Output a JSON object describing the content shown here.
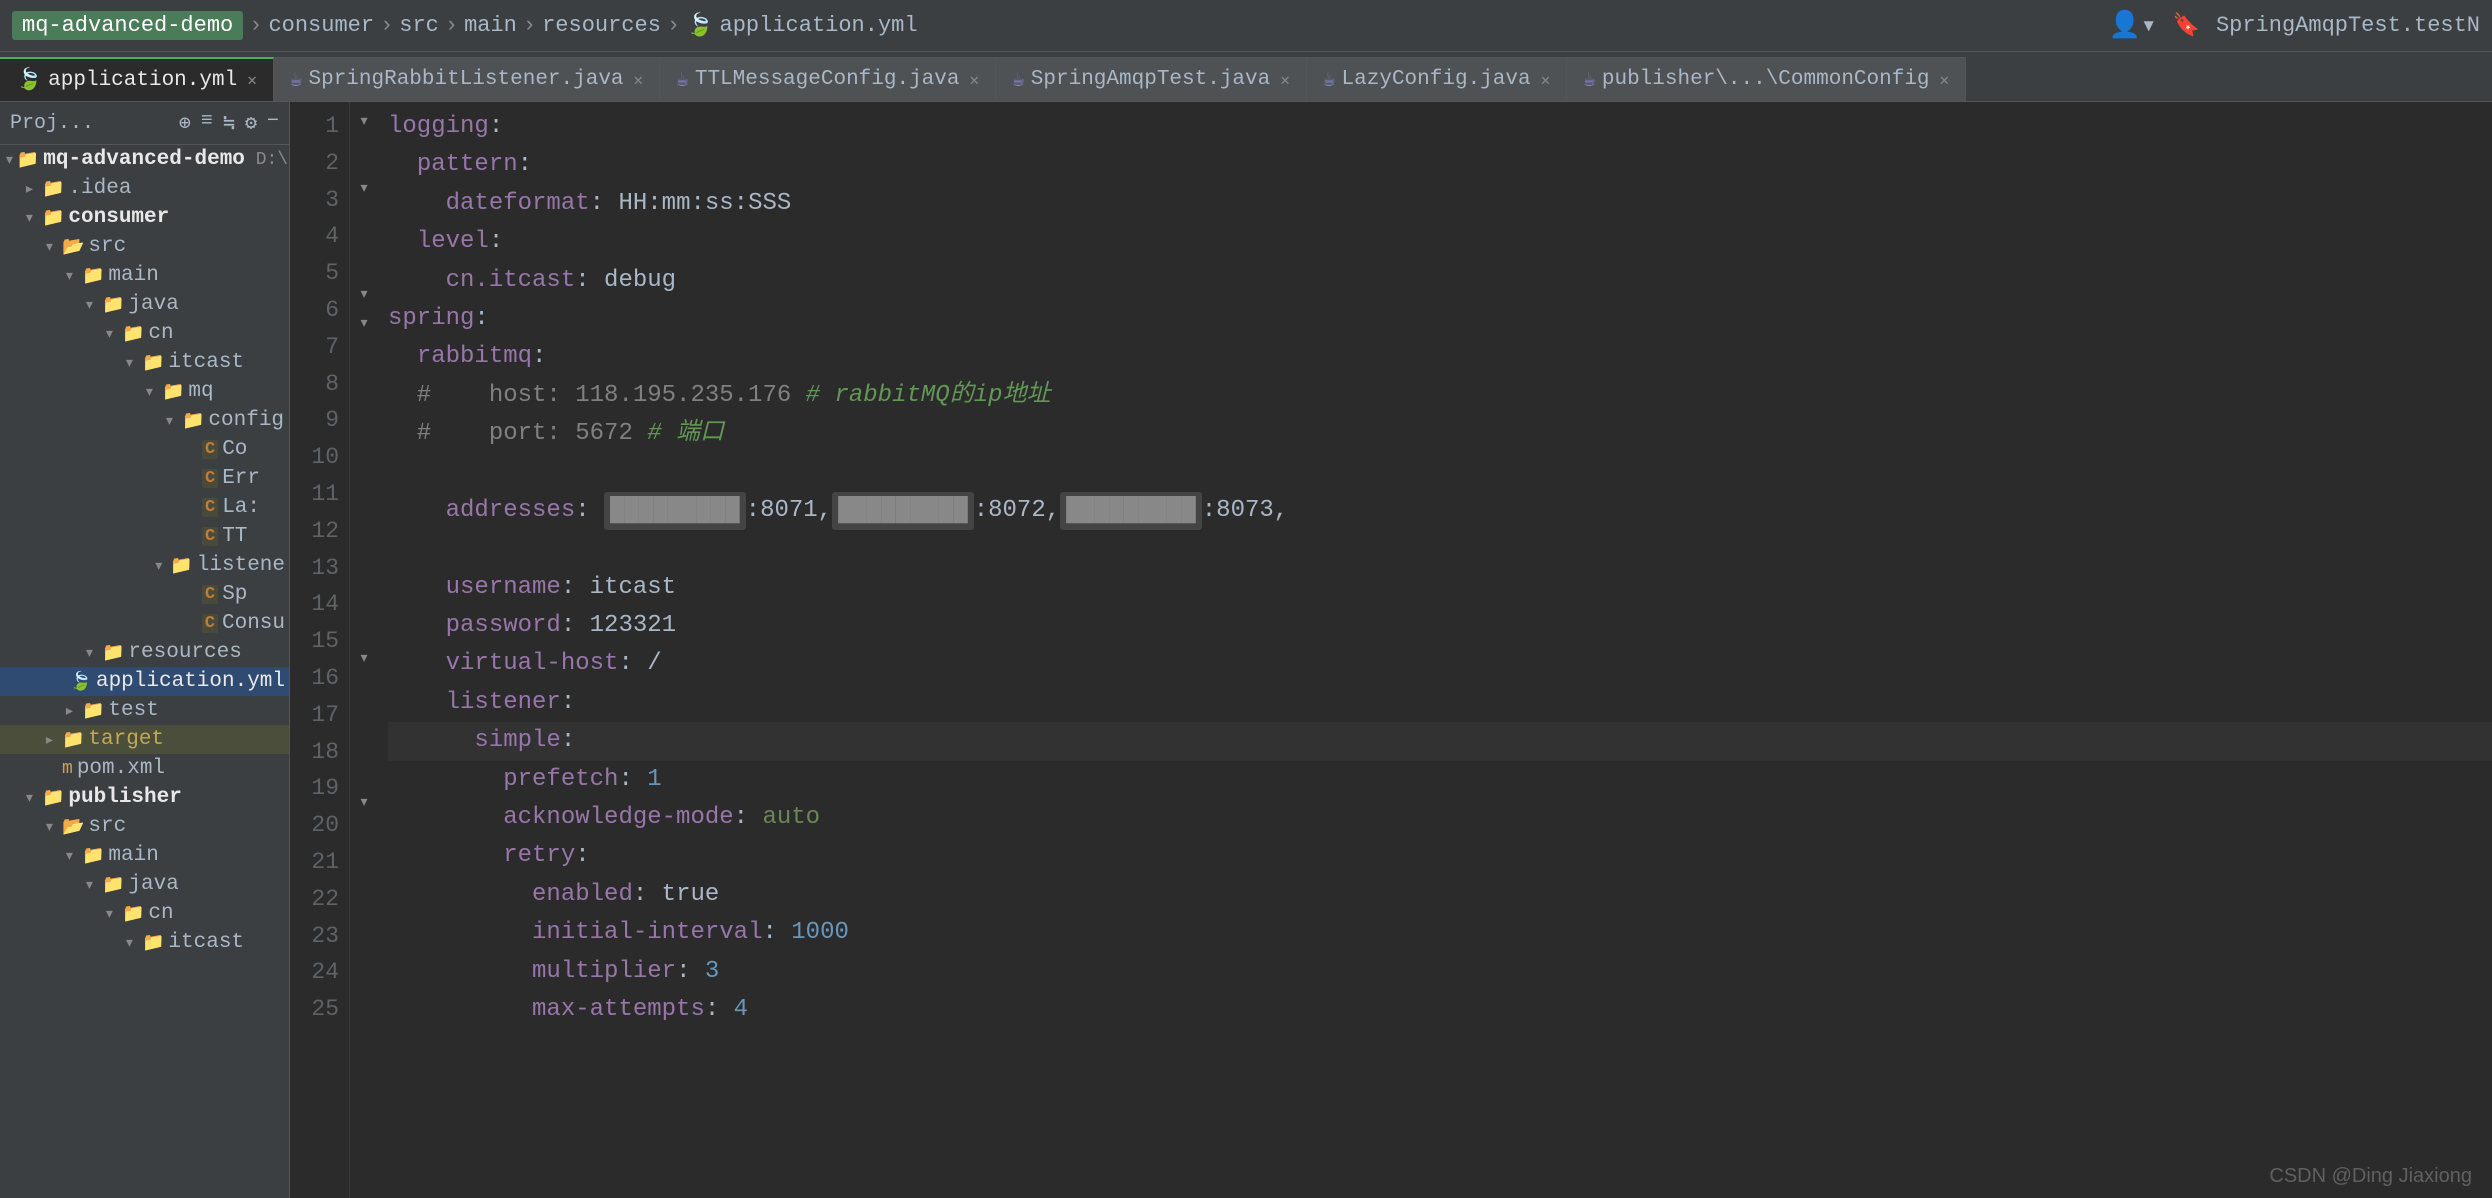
{
  "topbar": {
    "project_name": "mq-advanced-demo",
    "breadcrumb": [
      "consumer",
      "src",
      "main",
      "resources",
      "application.yml"
    ],
    "right_test": "SpringAmqpTest.testN"
  },
  "tabs": [
    {
      "id": "application-yml",
      "label": "application.yml",
      "type": "yaml",
      "active": true
    },
    {
      "id": "spring-rabbit-listener",
      "label": "SpringRabbitListener.java",
      "type": "java",
      "active": false
    },
    {
      "id": "ttl-message-config",
      "label": "TTLMessageConfig.java",
      "type": "java",
      "active": false
    },
    {
      "id": "spring-amqp-test",
      "label": "SpringAmqpTest.java",
      "type": "java",
      "active": false
    },
    {
      "id": "lazy-config",
      "label": "LazyConfig.java",
      "type": "java",
      "active": false
    },
    {
      "id": "publisher-common-config",
      "label": "publisher\\...\\CommonConfig",
      "type": "java",
      "active": false
    }
  ],
  "sidebar": {
    "header": "Proj...",
    "tree": [
      {
        "id": "root",
        "label": "mq-advanced-demo",
        "path": "D:\\Ding..",
        "level": 0,
        "type": "root",
        "expanded": true
      },
      {
        "id": "idea",
        "label": ".idea",
        "level": 1,
        "type": "folder",
        "expanded": false
      },
      {
        "id": "consumer",
        "label": "consumer",
        "level": 1,
        "type": "folder-bold",
        "expanded": true
      },
      {
        "id": "src",
        "label": "src",
        "level": 2,
        "type": "folder",
        "expanded": true
      },
      {
        "id": "main",
        "label": "main",
        "level": 3,
        "type": "folder",
        "expanded": true
      },
      {
        "id": "java",
        "label": "java",
        "level": 4,
        "type": "folder",
        "expanded": true
      },
      {
        "id": "cn",
        "label": "cn",
        "level": 5,
        "type": "folder",
        "expanded": true
      },
      {
        "id": "itcast",
        "label": "itcast",
        "level": 6,
        "type": "folder",
        "expanded": true
      },
      {
        "id": "mq",
        "label": "mq",
        "level": 7,
        "type": "folder",
        "expanded": true
      },
      {
        "id": "config",
        "label": "config",
        "level": 8,
        "type": "folder",
        "expanded": true
      },
      {
        "id": "cc",
        "label": "Co",
        "level": 9,
        "type": "class"
      },
      {
        "id": "err",
        "label": "Err",
        "level": 9,
        "type": "class"
      },
      {
        "id": "la",
        "label": "La:",
        "level": 9,
        "type": "class"
      },
      {
        "id": "tt",
        "label": "TT",
        "level": 9,
        "type": "class"
      },
      {
        "id": "listener",
        "label": "listene",
        "level": 8,
        "type": "folder",
        "expanded": true
      },
      {
        "id": "sp",
        "label": "Sp",
        "level": 9,
        "type": "class"
      },
      {
        "id": "consu",
        "label": "Consu",
        "level": 9,
        "type": "class"
      },
      {
        "id": "resources",
        "label": "resources",
        "level": 4,
        "type": "folder",
        "expanded": true
      },
      {
        "id": "application-yml-file",
        "label": "application.yml",
        "level": 5,
        "type": "yaml-file",
        "selected": true
      },
      {
        "id": "test",
        "label": "test",
        "level": 3,
        "type": "folder",
        "expanded": false
      },
      {
        "id": "target",
        "label": "target",
        "level": 2,
        "type": "folder-yellow",
        "expanded": false
      },
      {
        "id": "pom-xml",
        "label": "pom.xml",
        "level": 2,
        "type": "xml-file"
      },
      {
        "id": "publisher",
        "label": "publisher",
        "level": 1,
        "type": "folder-bold",
        "expanded": true
      },
      {
        "id": "pub-src",
        "label": "src",
        "level": 2,
        "type": "folder",
        "expanded": true
      },
      {
        "id": "pub-main",
        "label": "main",
        "level": 3,
        "type": "folder",
        "expanded": true
      },
      {
        "id": "pub-java",
        "label": "java",
        "level": 4,
        "type": "folder",
        "expanded": true
      },
      {
        "id": "pub-cn",
        "label": "cn",
        "level": 5,
        "type": "folder",
        "expanded": true
      },
      {
        "id": "pub-itcast",
        "label": "itcast",
        "level": 6,
        "type": "folder",
        "expanded": true
      }
    ]
  },
  "editor": {
    "filename": "application.yml",
    "lines": [
      {
        "num": 1,
        "indent": "",
        "content": "logging:",
        "type": "key"
      },
      {
        "num": 2,
        "indent": "  ",
        "content": "pattern:",
        "type": "key"
      },
      {
        "num": 3,
        "indent": "    ",
        "content": "dateformat: HH:mm:ss:SSS",
        "type": "keyval",
        "key": "dateformat",
        "val": "HH:mm:ss:SSS"
      },
      {
        "num": 4,
        "indent": "  ",
        "content": "level:",
        "type": "key"
      },
      {
        "num": 5,
        "indent": "    ",
        "content": "cn.itcast: debug",
        "type": "keyval",
        "key": "cn.itcast",
        "val": "debug"
      },
      {
        "num": 6,
        "indent": "",
        "content": "spring:",
        "type": "key"
      },
      {
        "num": 7,
        "indent": "  ",
        "content": "rabbitmq:",
        "type": "key"
      },
      {
        "num": 8,
        "indent": "  ",
        "content": "#    host: 118.195.235.176 # rabbitMQ的ip地址",
        "type": "comment"
      },
      {
        "num": 9,
        "indent": "  ",
        "content": "#    port: 5672 # 端口",
        "type": "comment"
      },
      {
        "num": 10,
        "indent": "",
        "content": "",
        "type": "empty"
      },
      {
        "num": 11,
        "indent": "    ",
        "content": "addresses: [REDACTED]:8071,[REDACTED]:8072,[REDACTED]:8073,",
        "type": "addresses"
      },
      {
        "num": 12,
        "indent": "",
        "content": "",
        "type": "empty"
      },
      {
        "num": 13,
        "indent": "    ",
        "content": "username: itcast",
        "type": "keyval",
        "key": "username",
        "val": "itcast"
      },
      {
        "num": 14,
        "indent": "    ",
        "content": "password: 123321",
        "type": "keyval",
        "key": "password",
        "val": "123321"
      },
      {
        "num": 15,
        "indent": "    ",
        "content": "virtual-host: /",
        "type": "keyval",
        "key": "virtual-host",
        "val": "/"
      },
      {
        "num": 16,
        "indent": "    ",
        "content": "listener:",
        "type": "key"
      },
      {
        "num": 17,
        "indent": "      ",
        "content": "simple:",
        "type": "key-active"
      },
      {
        "num": 18,
        "indent": "        ",
        "content": "prefetch: 1",
        "type": "keyval",
        "key": "prefetch",
        "val": "1"
      },
      {
        "num": 19,
        "indent": "        ",
        "content": "acknowledge-mode: auto",
        "type": "keyval-string",
        "key": "acknowledge-mode",
        "val": "auto"
      },
      {
        "num": 20,
        "indent": "        ",
        "content": "retry:",
        "type": "key"
      },
      {
        "num": 21,
        "indent": "          ",
        "content": "enabled: true",
        "type": "keyval",
        "key": "enabled",
        "val": "true"
      },
      {
        "num": 22,
        "indent": "          ",
        "content": "initial-interval: 1000",
        "type": "keyval",
        "key": "initial-interval",
        "val": "1000"
      },
      {
        "num": 23,
        "indent": "          ",
        "content": "multiplier: 3",
        "type": "keyval",
        "key": "multiplier",
        "val": "3"
      },
      {
        "num": 24,
        "indent": "          ",
        "content": "max-attempts: 4",
        "type": "keyval",
        "key": "max-attempts",
        "val": "4"
      },
      {
        "num": 25,
        "indent": "",
        "content": "",
        "type": "empty"
      }
    ]
  },
  "watermark": "CSDN @Ding Jiaxiong"
}
